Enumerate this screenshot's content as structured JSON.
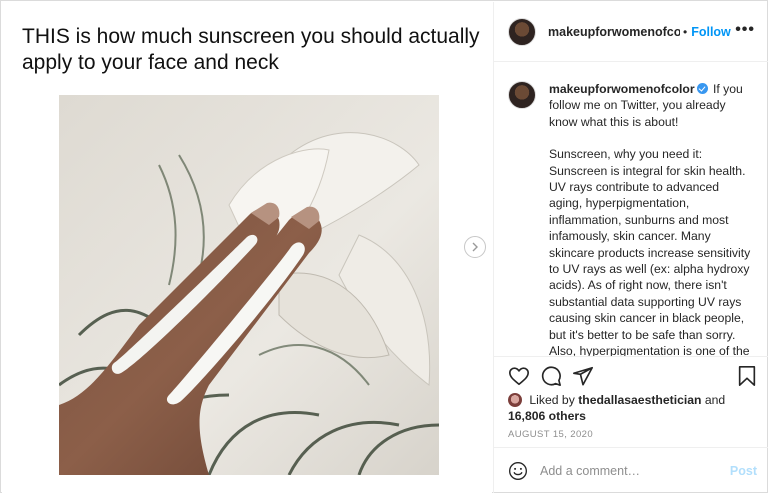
{
  "media": {
    "title": "THIS is how much sunscreen you should actually apply to your face and neck"
  },
  "header": {
    "username": "makeupforwomenofcolc",
    "separator": "•",
    "follow_label": "Follow",
    "more_label": "•••"
  },
  "caption": {
    "username": "makeupforwomenofcolor",
    "intro": "If you follow me on Twitter, you already know what this is about!",
    "body": "Sunscreen, why you need it: Sunscreen is integral for skin health. UV rays contribute to advanced aging, hyperpigmentation, inflammation, sunburns and most infamously, skin cancer. Many skincare products increase sensitivity to UV rays as well (ex: alpha hydroxy acids). As of right now, there isn't substantial data supporting UV rays causing skin cancer in black people, but it's better to be safe than sorry. Also, hyperpigmentation is one of the most common cosmetic concerns for"
  },
  "likes": {
    "prefix": "Liked by",
    "user": "thedallasaesthetician",
    "joiner": "and",
    "count": "16,806 others"
  },
  "date": "AUGUST 15, 2020",
  "comment": {
    "placeholder": "Add a comment…",
    "post_label": "Post"
  },
  "colors": {
    "accent": "#0095f6",
    "post_disabled": "#b2dffc",
    "muted": "#8e8e8e",
    "text": "#262626"
  },
  "icons": [
    "heart-icon",
    "comment-icon",
    "share-icon",
    "bookmark-icon",
    "smiley-icon",
    "chevron-right-icon",
    "verified-icon"
  ]
}
